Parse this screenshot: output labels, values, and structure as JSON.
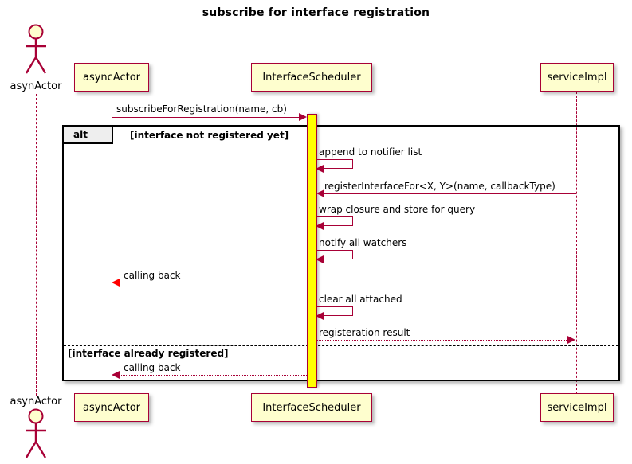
{
  "title": "subscribe for interface registration",
  "actor": {
    "name": "asynActor",
    "icon": "actor-stick-figure"
  },
  "participants": [
    {
      "id": "asyncActor",
      "label": "asyncActor"
    },
    {
      "id": "InterfaceScheduler",
      "label": "InterfaceScheduler"
    },
    {
      "id": "serviceImpl",
      "label": "serviceImpl"
    }
  ],
  "fragment": {
    "type_label": "alt",
    "guards": [
      "[interface not registered yet]",
      "[interface already registered]"
    ]
  },
  "messages": [
    {
      "id": "m1",
      "label": "subscribeForRegistration(name, cb)",
      "from": "asyncActor",
      "to": "InterfaceScheduler",
      "style": "solid",
      "direction": "right"
    },
    {
      "id": "m2",
      "label": "append to notifier list",
      "from": "InterfaceScheduler",
      "to": "InterfaceScheduler",
      "style": "self",
      "direction": "self"
    },
    {
      "id": "m3",
      "label": "registerInterfaceFor<X, Y>(name, callbackType)",
      "from": "serviceImpl",
      "to": "InterfaceScheduler",
      "style": "solid",
      "direction": "left"
    },
    {
      "id": "m4",
      "label": "wrap closure and store for query",
      "from": "InterfaceScheduler",
      "to": "InterfaceScheduler",
      "style": "self",
      "direction": "self"
    },
    {
      "id": "m5",
      "label": "notify all watchers",
      "from": "InterfaceScheduler",
      "to": "InterfaceScheduler",
      "style": "self",
      "direction": "self"
    },
    {
      "id": "m6",
      "label": "calling back",
      "from": "InterfaceScheduler",
      "to": "asyncActor",
      "style": "dotted-red",
      "direction": "left"
    },
    {
      "id": "m7",
      "label": "clear all attached",
      "from": "InterfaceScheduler",
      "to": "InterfaceScheduler",
      "style": "self",
      "direction": "self"
    },
    {
      "id": "m8",
      "label": "registeration result",
      "from": "InterfaceScheduler",
      "to": "serviceImpl",
      "style": "dotted-dark",
      "direction": "right"
    },
    {
      "id": "m9",
      "label": "calling back",
      "from": "InterfaceScheduler",
      "to": "asyncActor",
      "style": "dotted-dark",
      "direction": "left"
    }
  ],
  "colors": {
    "participant_fill": "#FEFECE",
    "participant_border": "#A80036",
    "lifeline": "#A80036",
    "activation_fill": "#FFFF00",
    "arrow_dark": "#A80036",
    "arrow_red": "#FF0000",
    "frame_border": "#000000",
    "frame_tab_fill": "#EEEEEE"
  }
}
